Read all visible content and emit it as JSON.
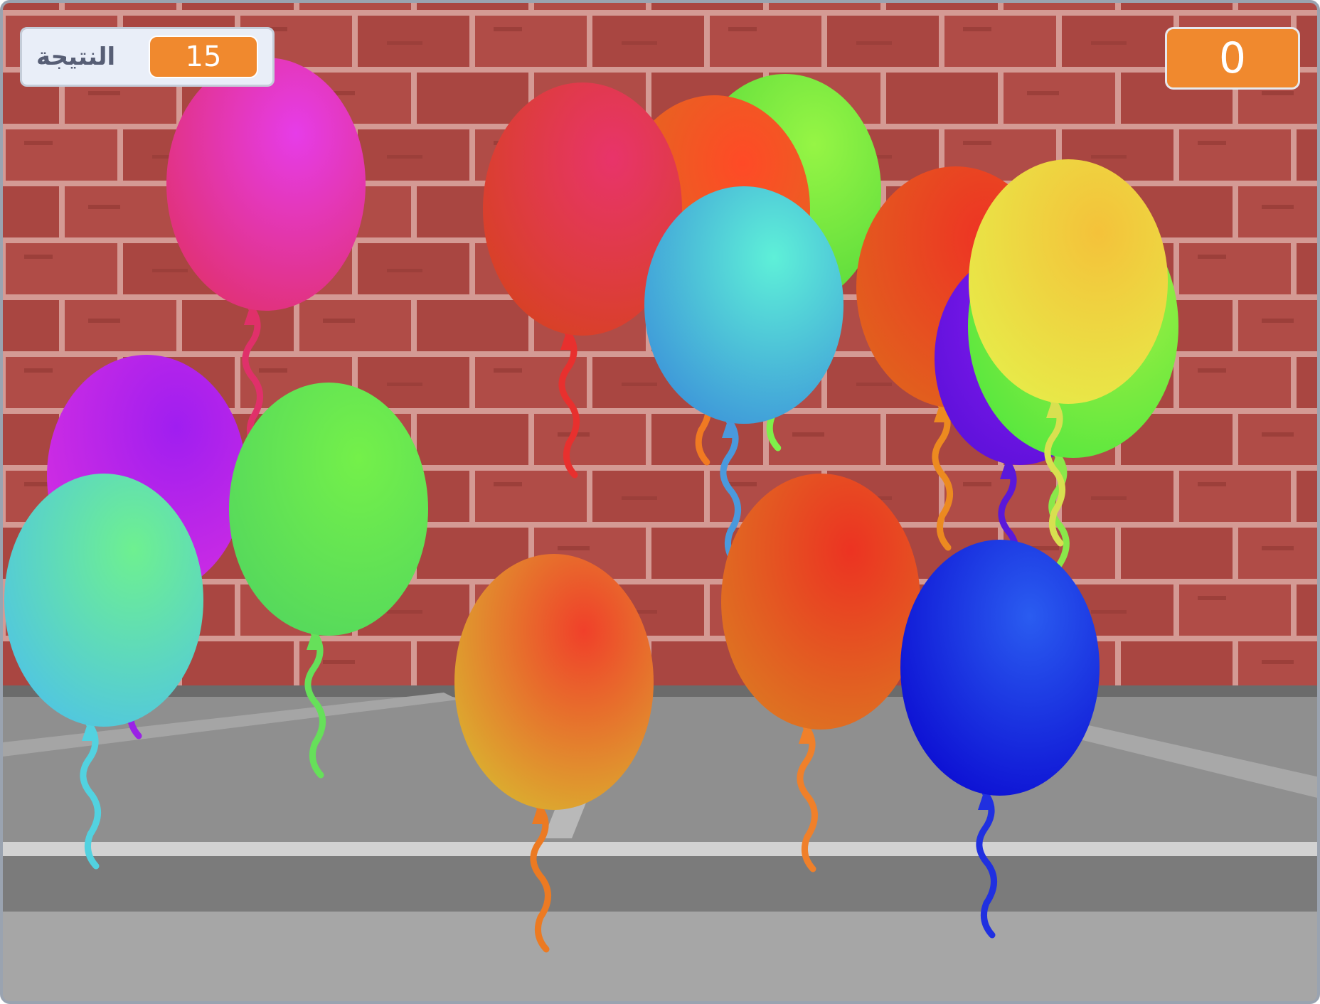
{
  "score_monitor": {
    "label": "النتيجة",
    "value": "15"
  },
  "counter": {
    "value": "0"
  },
  "colors": {
    "brick": "#b04a45",
    "mortar": "#d99a94",
    "pavement": "#8e8e8e",
    "monitor_orange": "#f0892e"
  },
  "balloons": [
    {
      "name": "magenta",
      "light": "#e63ce8",
      "dark": "#e0306a",
      "string": "#e0306a"
    },
    {
      "name": "green",
      "light": "#96f545",
      "dark": "#4fd63a",
      "string": "#7ef04a"
    },
    {
      "name": "orange",
      "light": "#ff4a26",
      "dark": "#d9701f",
      "string": "#f07a22"
    },
    {
      "name": "red",
      "light": "#e8346a",
      "dark": "#d6421e",
      "string": "#e8302e"
    },
    {
      "name": "cyan",
      "light": "#5ef0d8",
      "dark": "#3b8fd9",
      "string": "#4a99dc"
    },
    {
      "name": "red",
      "light": "#ee3324",
      "dark": "#e0651d",
      "string": "#ec8a20"
    },
    {
      "name": "purple",
      "light": "#8a1cf2",
      "dark": "#5a10d8",
      "string": "#5a18da"
    },
    {
      "name": "green",
      "light": "#aef043",
      "dark": "#4fe63e",
      "string": "#8ae84a"
    },
    {
      "name": "yellow",
      "light": "#f4c23a",
      "dark": "#e6ee4a",
      "string": "#d8e050"
    },
    {
      "name": "purple",
      "light": "#a01ef0",
      "dark": "#d72fe0",
      "string": "#9a22e6"
    },
    {
      "name": "green",
      "light": "#74f04a",
      "dark": "#52d65e",
      "string": "#66e05a"
    },
    {
      "name": "teal",
      "light": "#6ef090",
      "dark": "#4ec2e8",
      "string": "#52d2e0"
    },
    {
      "name": "orange",
      "light": "#f0402a",
      "dark": "#d9b830",
      "string": "#ec7a22"
    },
    {
      "name": "orange",
      "light": "#ec3322",
      "dark": "#dc7a22",
      "string": "#f0802a"
    },
    {
      "name": "blue",
      "light": "#2a5cf0",
      "dark": "#0a08d0",
      "string": "#2030e0"
    }
  ]
}
